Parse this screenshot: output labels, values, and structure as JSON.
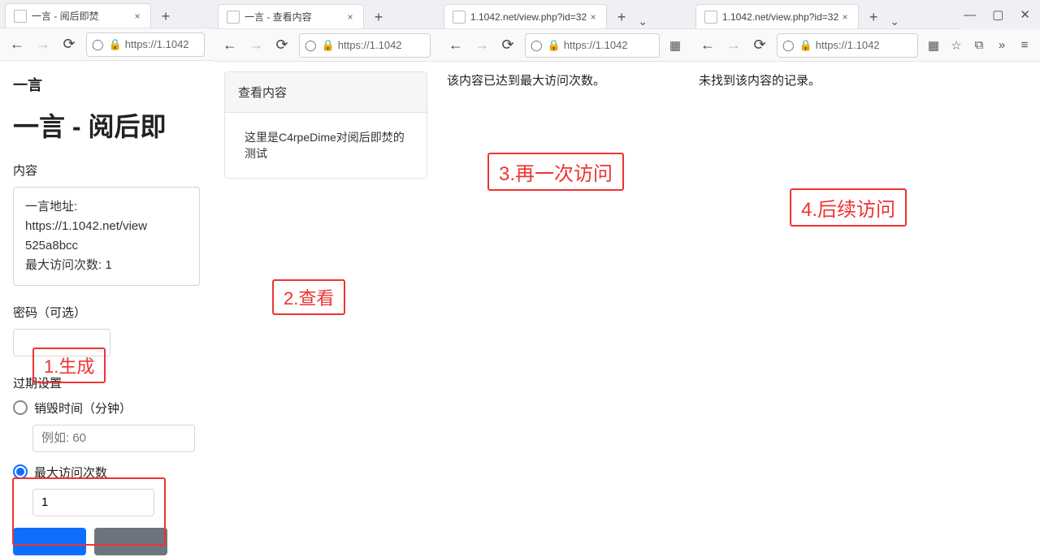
{
  "panes": {
    "p1": {
      "tab_title": "一言 - 阅后即焚",
      "url": "https://1.1042",
      "brand": "一言",
      "page_title": "一言 - 阅后即",
      "content_label": "内容",
      "textarea_lines": {
        "l1": "一言地址: https://1.1042.net/view",
        "l2": "525a8bcc",
        "l3": "最大访问次数: 1"
      },
      "password_label": "密码（可选）",
      "expire_label": "过期设置",
      "radio_time_label": "销毁时间（分钟）",
      "time_placeholder": "例如: 60",
      "radio_count_label": "最大访问次数",
      "count_value": "1"
    },
    "p2": {
      "tab_title": "一言 - 查看内容",
      "url": "https://1.1042",
      "card_header": "查看内容",
      "card_body": "这里是C4rpeDime对阅后即焚的测试"
    },
    "p3": {
      "tab_title": "1.1042.net/view.php?id=32",
      "url": "https://1.1042",
      "message": "该内容已达到最大访问次数。"
    },
    "p4": {
      "tab_title": "1.1042.net/view.php?id=32",
      "url": "https://1.1042",
      "message": "未找到该内容的记录。"
    }
  },
  "callouts": {
    "c1": "1.生成",
    "c2": "2.查看",
    "c3": "3.再一次访问",
    "c4": "4.后续访问"
  },
  "icons": {
    "back": "←",
    "forward": "→",
    "reload": "⟳",
    "shield": "◯",
    "lock": "🔒",
    "close": "×",
    "plus": "+",
    "menu": "≡",
    "chevdown": "⌄",
    "min": "—",
    "max": "▢",
    "x": "✕",
    "star": "☆",
    "ext": "⧉",
    "more": "»",
    "qr": "▦"
  }
}
